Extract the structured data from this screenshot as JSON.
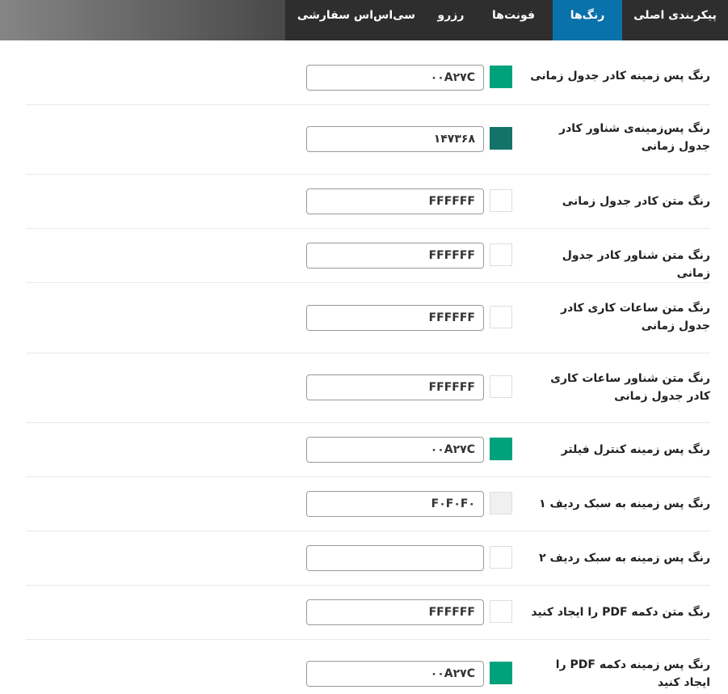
{
  "tabs": [
    {
      "label": "پیکربندی اصلی",
      "active": false
    },
    {
      "label": "رنگ‌ها",
      "active": true
    },
    {
      "label": "فونت‌ها",
      "active": false
    },
    {
      "label": "رزرو",
      "active": false
    },
    {
      "label": "سی‌اس‌اس سفارشی",
      "active": false
    }
  ],
  "colors": {
    "active_tab": "#0a72aa",
    "tabbar": "#2e2e2e"
  },
  "rows": [
    {
      "label": "رنگ پس زمینه کادر جدول زمانی",
      "value": "۰۰A۲۷C",
      "swatch": "#00a27c"
    },
    {
      "label": "رنگ پس‌زمینه‌ی شناور کادر جدول زمانی",
      "value": "۱۴۷۳۶۸",
      "swatch": "#147368"
    },
    {
      "label": "رنگ متن کادر جدول زمانی",
      "value": "FFFFFF",
      "swatch": "#ffffff"
    },
    {
      "label": "رنگ متن شناور کادر جدول زمانی",
      "value": "FFFFFF",
      "swatch": "#ffffff"
    },
    {
      "label": "رنگ متن ساعات کاری کادر جدول زمانی",
      "value": "FFFFFF",
      "swatch": "#ffffff"
    },
    {
      "label": "رنگ متن شناور ساعات کاری کادر جدول زمانی",
      "value": "FFFFFF",
      "swatch": "#ffffff"
    },
    {
      "label": "رنگ پس زمینه کنترل فیلتر",
      "value": "۰۰A۲۷C",
      "swatch": "#00a27c"
    },
    {
      "label": "رنگ پس زمینه به سبک ردیف ۱",
      "value": "F۰F۰F۰",
      "swatch": "#f0f0f0"
    },
    {
      "label": "رنگ پس زمینه به سبک ردیف ۲",
      "value": "",
      "swatch": "#ffffff"
    },
    {
      "label": "رنگ متن دکمه PDF را ایجاد کنید",
      "value": "FFFFFF",
      "swatch": "#ffffff"
    },
    {
      "label": "رنگ پس زمینه دکمه PDF را ایجاد کنید",
      "value": "۰۰A۲۷C",
      "swatch": "#00a27c"
    }
  ]
}
